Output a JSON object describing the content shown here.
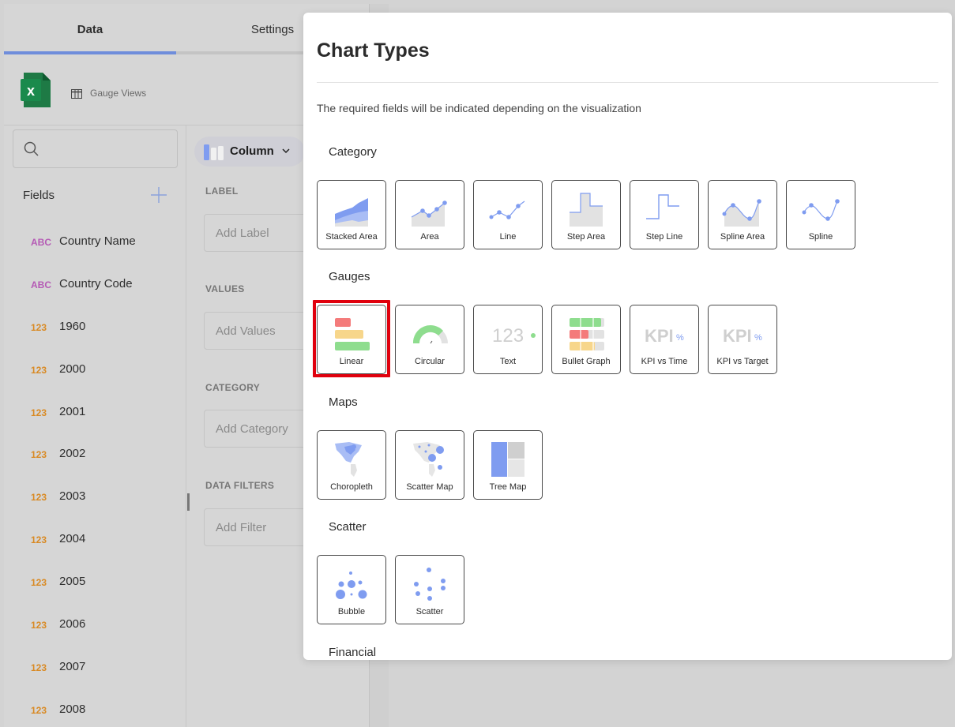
{
  "tabs": {
    "data": "Data",
    "settings": "Settings"
  },
  "source": {
    "label": "Gauge Views",
    "icon": "excel-icon"
  },
  "fields": {
    "title": "Fields",
    "items": [
      {
        "type": "ABC",
        "name": "Country Name"
      },
      {
        "type": "ABC",
        "name": "Country Code"
      },
      {
        "type": "123",
        "name": "1960"
      },
      {
        "type": "123",
        "name": "2000"
      },
      {
        "type": "123",
        "name": "2001"
      },
      {
        "type": "123",
        "name": "2002"
      },
      {
        "type": "123",
        "name": "2003"
      },
      {
        "type": "123",
        "name": "2004"
      },
      {
        "type": "123",
        "name": "2005"
      },
      {
        "type": "123",
        "name": "2006"
      },
      {
        "type": "123",
        "name": "2007"
      },
      {
        "type": "123",
        "name": "2008"
      }
    ]
  },
  "config": {
    "chart_type": "Column",
    "label": {
      "title": "LABEL",
      "placeholder": "Add Label"
    },
    "values": {
      "title": "VALUES",
      "placeholder": "Add Values"
    },
    "category": {
      "title": "CATEGORY",
      "placeholder": "Add Category"
    },
    "filters": {
      "title": "DATA FILTERS",
      "placeholder": "Add Filter"
    }
  },
  "dialog": {
    "title": "Chart Types",
    "description": "The required fields will be indicated depending on the visualization",
    "sections": {
      "category": {
        "title": "Category",
        "items": [
          "Stacked Area",
          "Area",
          "Line",
          "Step Area",
          "Step Line",
          "Spline Area",
          "Spline"
        ]
      },
      "gauges": {
        "title": "Gauges",
        "items": [
          "Linear",
          "Circular",
          "Text",
          "Bullet Graph",
          "KPI vs Time",
          "KPI vs Target"
        ],
        "selected": "Linear"
      },
      "maps": {
        "title": "Maps",
        "items": [
          "Choropleth",
          "Scatter Map",
          "Tree Map"
        ]
      },
      "scatter": {
        "title": "Scatter",
        "items": [
          "Bubble",
          "Scatter"
        ]
      },
      "financial": {
        "title": "Financial"
      }
    },
    "icon_text": {
      "text_number": "123",
      "kpi": "KPI",
      "percent": "%"
    }
  },
  "colors": {
    "accent_blue": "#7f9cf0",
    "light_blue": "#a9bdf5",
    "gray_fill": "#e2e2e2",
    "red": "#f47b7b",
    "yellow": "#f7d68b",
    "green": "#8edd8e",
    "selection_red": "#e0000d"
  }
}
